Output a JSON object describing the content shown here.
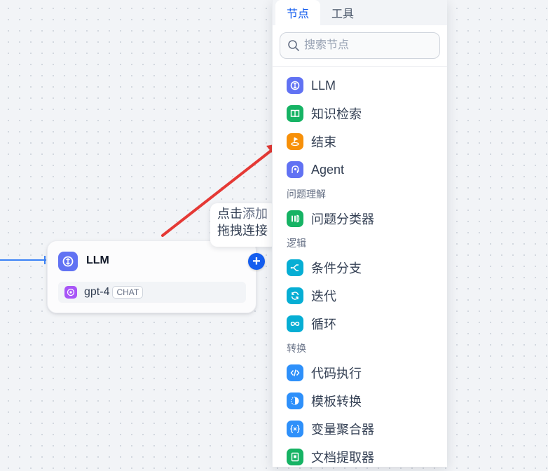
{
  "panel": {
    "tabs": [
      {
        "label": "节点",
        "active": true
      },
      {
        "label": "工具",
        "active": false
      }
    ],
    "search_placeholder": "搜索节点",
    "items_a": [
      {
        "label": "LLM",
        "icon": "llm-icon",
        "color": "#6172f3"
      },
      {
        "label": "知识检索",
        "icon": "book-icon",
        "color": "#16b364"
      },
      {
        "label": "结束",
        "icon": "end-icon",
        "color": "#f79009"
      },
      {
        "label": "Agent",
        "icon": "agent-icon",
        "color": "#6172f3"
      }
    ],
    "group_understanding": "问题理解",
    "items_b": [
      {
        "label": "问题分类器",
        "icon": "classifier-icon",
        "color": "#16b364"
      }
    ],
    "group_logic": "逻辑",
    "items_c": [
      {
        "label": "条件分支",
        "icon": "branch-icon",
        "color": "#06aed4"
      },
      {
        "label": "迭代",
        "icon": "iteration-icon",
        "color": "#06aed4"
      },
      {
        "label": "循环",
        "icon": "loop-icon",
        "color": "#06aed4"
      }
    ],
    "group_transform": "转换",
    "items_d": [
      {
        "label": "代码执行",
        "icon": "code-icon",
        "color": "#2e90fa"
      },
      {
        "label": "模板转换",
        "icon": "template-icon",
        "color": "#2e90fa"
      },
      {
        "label": "变量聚合器",
        "icon": "variable-icon",
        "color": "#2e90fa"
      },
      {
        "label": "文档提取器",
        "icon": "doc-extract-icon",
        "color": "#16b364"
      }
    ]
  },
  "node": {
    "title": "LLM",
    "model": "gpt-4",
    "badge": "CHAT",
    "add": "+"
  },
  "tooltip": {
    "line1_a": "点击",
    "line1_b": "添加",
    "line2_a": "拖拽",
    "line2_b": "连接"
  },
  "colors": {
    "accent": "#155eef",
    "arrow": "#e53935",
    "edge": "#3b82f6"
  }
}
